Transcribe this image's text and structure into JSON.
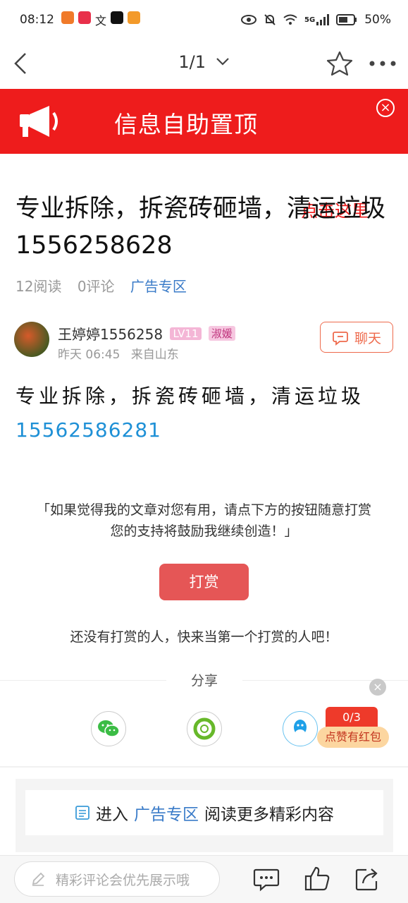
{
  "status_bar": {
    "time": "08:12",
    "battery": "50%",
    "network": "5G"
  },
  "nav": {
    "page_indicator": "1/1"
  },
  "banner": {
    "title": "信息自助置顶",
    "button_label": "点击这里",
    "close_label": "×",
    "bg_color": "#ee1c1c"
  },
  "article": {
    "title": "专业拆除，拆瓷砖砸墙，清运垃圾1556258628",
    "reads": "12阅读",
    "comments": "0评论",
    "category": "广告专区",
    "body_text": "专业拆除，拆瓷砖砸墙，清运垃圾",
    "phone": "15562586281"
  },
  "author": {
    "name": "王婷婷1556258",
    "level": "LV11",
    "title_tag": "淑媛",
    "time": "昨天 06:45",
    "from": "来自山东",
    "chat_label": "聊天"
  },
  "reward": {
    "tip_line1": "「如果觉得我的文章对您有用，请点下方的按钮随意打赏",
    "tip_line2": "您的支持将鼓励我继续创造！」",
    "button_label": "打赏",
    "empty_text": "还没有打赏的人，快来当第一个打赏的人吧！"
  },
  "share": {
    "label": "分享",
    "items": [
      "wechat-icon",
      "moments-icon",
      "qq-icon"
    ]
  },
  "red_packet": {
    "count": "0/3",
    "label": "点赞有红包",
    "close_label": "×"
  },
  "more": {
    "prefix": "进入",
    "category": "广告专区",
    "suffix": "阅读更多精彩内容"
  },
  "bottom_bar": {
    "comment_placeholder": "精彩评论会优先展示哦"
  }
}
